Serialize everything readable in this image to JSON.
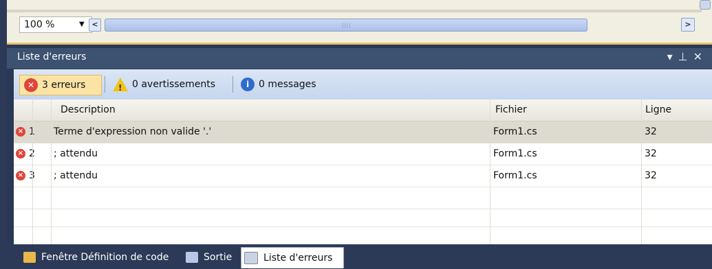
{
  "editor": {
    "zoom": "100 %"
  },
  "errorList": {
    "title": "Liste d'erreurs",
    "window_controls": "▾ ⊥ ✕",
    "filters": [
      {
        "label": "3 erreurs",
        "icon": "error-icon",
        "active": true
      },
      {
        "label": "0 avertissements",
        "icon": "warning-icon",
        "active": false
      },
      {
        "label": "0 messages",
        "icon": "info-icon",
        "active": false
      }
    ],
    "columns": {
      "description": "Description",
      "file": "Fichier",
      "line": "Ligne"
    },
    "rows": [
      {
        "num": "1",
        "description": "Terme d'expression non valide '.'",
        "file": "Form1.cs",
        "line": "32"
      },
      {
        "num": "2",
        "description": "; attendu",
        "file": "Form1.cs",
        "line": "32"
      },
      {
        "num": "3",
        "description": "; attendu",
        "file": "Form1.cs",
        "line": "32"
      }
    ]
  },
  "bottomTabs": [
    {
      "label": "Fenêtre Définition de code",
      "icon": "code-definition-icon"
    },
    {
      "label": "Sortie",
      "icon": "output-icon"
    },
    {
      "label": "Liste d'erreurs",
      "icon": "error-list-icon",
      "active": true
    }
  ],
  "colors": {
    "error": "#e0453a",
    "warning": "#f2c20e",
    "info": "#2f6dcc",
    "titlebar": "#3d5170"
  }
}
